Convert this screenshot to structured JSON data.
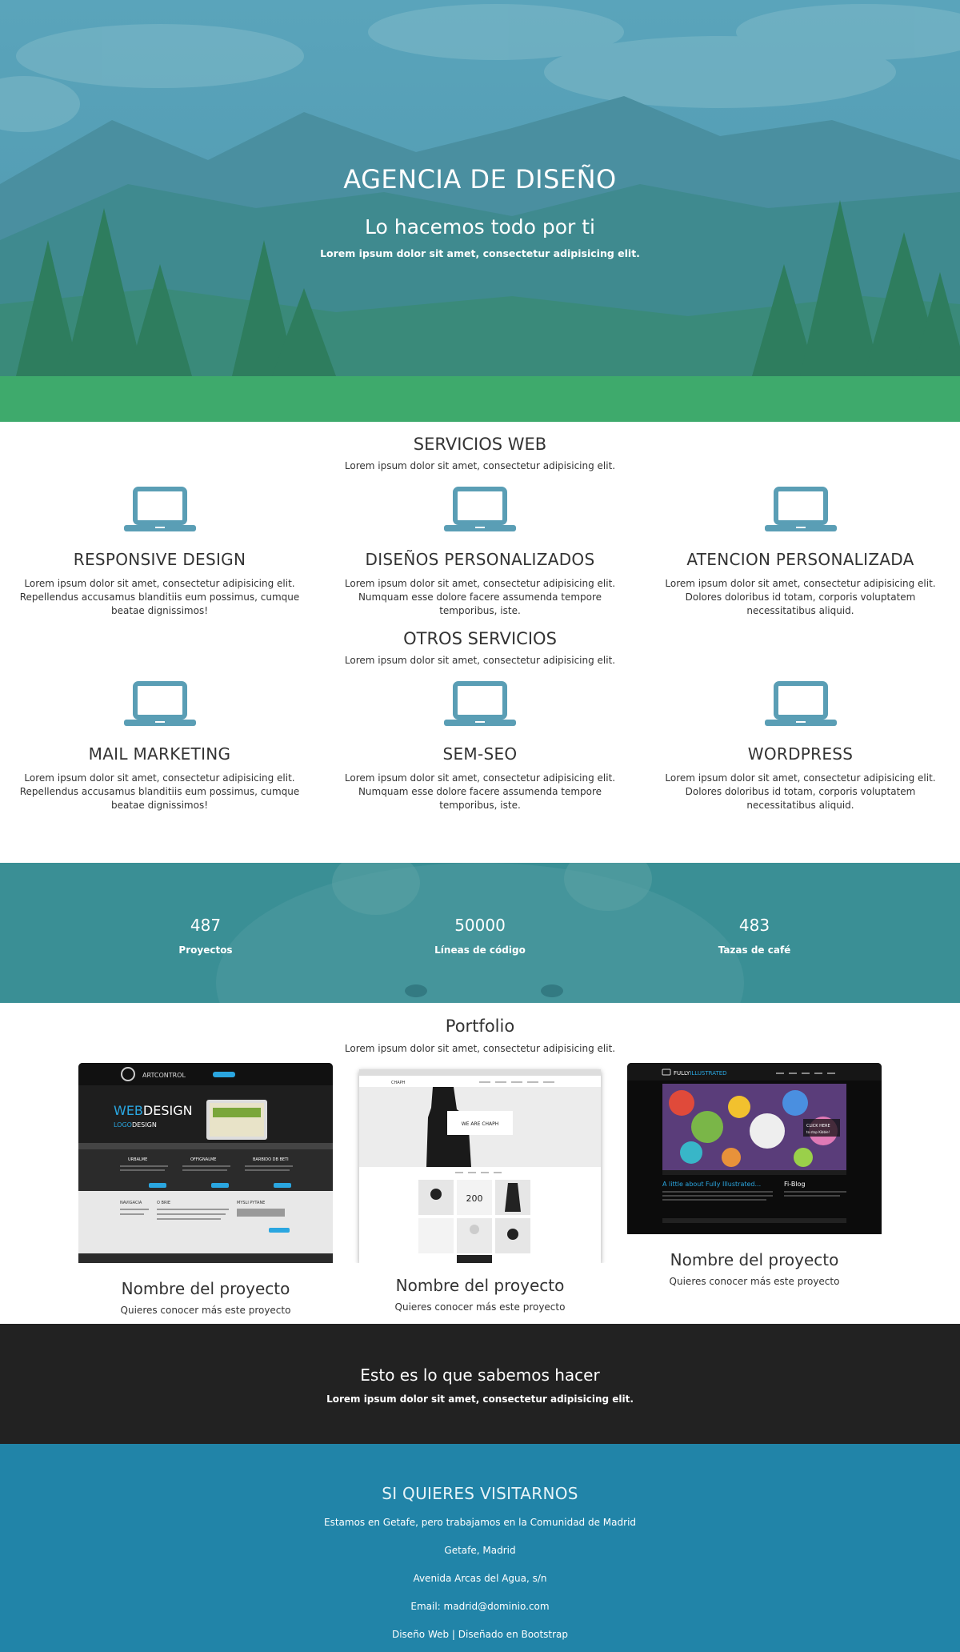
{
  "hero": {
    "title": "AGENCIA DE DISEÑO",
    "subtitle": "Lo hacemos todo por ti",
    "text": "Lorem ipsum dolor sit amet, consectetur adipisicing elit."
  },
  "services_web": {
    "title": "SERVICIOS WEB",
    "subtitle": "Lorem ipsum dolor sit amet, consectetur adipisicing elit.",
    "items": [
      {
        "icon": "laptop-icon",
        "title": "RESPONSIVE DESIGN",
        "text": "Lorem ipsum dolor sit amet, consectetur adipisicing elit. Repellendus accusamus blanditiis eum possimus, cumque beatae dignissimos!"
      },
      {
        "icon": "laptop-icon",
        "title": "DISEÑOS PERSONALIZADOS",
        "text": "Lorem ipsum dolor sit amet, consectetur adipisicing elit. Numquam esse dolore facere assumenda tempore temporibus, iste."
      },
      {
        "icon": "laptop-icon",
        "title": "ATENCION PERSONALIZADA",
        "text": "Lorem ipsum dolor sit amet, consectetur adipisicing elit. Dolores doloribus id totam, corporis voluptatem necessitatibus aliquid."
      }
    ]
  },
  "services_other": {
    "title": "OTROS SERVICIOS",
    "subtitle": "Lorem ipsum dolor sit amet, consectetur adipisicing elit.",
    "items": [
      {
        "icon": "laptop-icon",
        "title": "MAIL MARKETING",
        "text": "Lorem ipsum dolor sit amet, consectetur adipisicing elit. Repellendus accusamus blanditiis eum possimus, cumque beatae dignissimos!"
      },
      {
        "icon": "laptop-icon",
        "title": "SEM-SEO",
        "text": "Lorem ipsum dolor sit amet, consectetur adipisicing elit. Numquam esse dolore facere assumenda tempore temporibus, iste."
      },
      {
        "icon": "laptop-icon",
        "title": "WORDPRESS",
        "text": "Lorem ipsum dolor sit amet, consectetur adipisicing elit. Dolores doloribus id totam, corporis voluptatem necessitatibus aliquid."
      }
    ]
  },
  "stats": [
    {
      "value": "487",
      "label": "Proyectos"
    },
    {
      "value": "50000",
      "label": "Líneas de código"
    },
    {
      "value": "483",
      "label": "Tazas de café"
    }
  ],
  "portfolio": {
    "title": "Portfolio",
    "subtitle": "Lorem ipsum dolor sit amet, consectetur adipisicing elit.",
    "items": [
      {
        "name": "Nombre del proyecto",
        "link": "Quieres conocer más este proyecto",
        "thumb": {
          "brand": "ARTCONTROL",
          "headline_a": "WEB",
          "headline_b": "DESIGN",
          "sub_a": "LOGO",
          "sub_b": "DESIGN",
          "cols": [
            "URBALME",
            "OFFIGNALME",
            "BARBIDO DB BETI"
          ],
          "footer_cols": [
            "NAVIGACIA",
            "O BRIE",
            "MYSLI PYTANE"
          ]
        }
      },
      {
        "name": "Nombre del proyecto",
        "link": "Quieres conocer más este proyecto",
        "thumb": {
          "brand": "CHAPH",
          "banner": "WE ARE CHAPH",
          "tile": "200"
        }
      },
      {
        "name": "Nombre del proyecto",
        "link": "Quieres conocer más este proyecto",
        "thumb": {
          "brand_a": "FULLY",
          "brand_b": "ILLUSTRATED",
          "caption": "A little about Fully Illustrated...",
          "side": "Fi-Blog",
          "cta": "CLICK HERE",
          "cta_sub": "to stop Kibble!"
        }
      }
    ]
  },
  "cta": {
    "title": "Esto es lo que sabemos hacer",
    "text": "Lorem ipsum dolor sit amet, consectetur adipisicing elit."
  },
  "footer": {
    "title": "SI QUIERES VISITARNOS",
    "lines": [
      "Estamos en Getafe, pero trabajamos en la Comunidad de Madrid",
      "Getafe, Madrid",
      "Avenida Arcas del Agua, s/n",
      "Email: madrid@dominio.com",
      "Diseño Web | Diseñado en Bootstrap"
    ]
  },
  "colors": {
    "icon": "#5a9eb5",
    "stats_overlay": "#3a8f95",
    "cta_bg": "#222222",
    "footer_bg": "#2184a8"
  }
}
